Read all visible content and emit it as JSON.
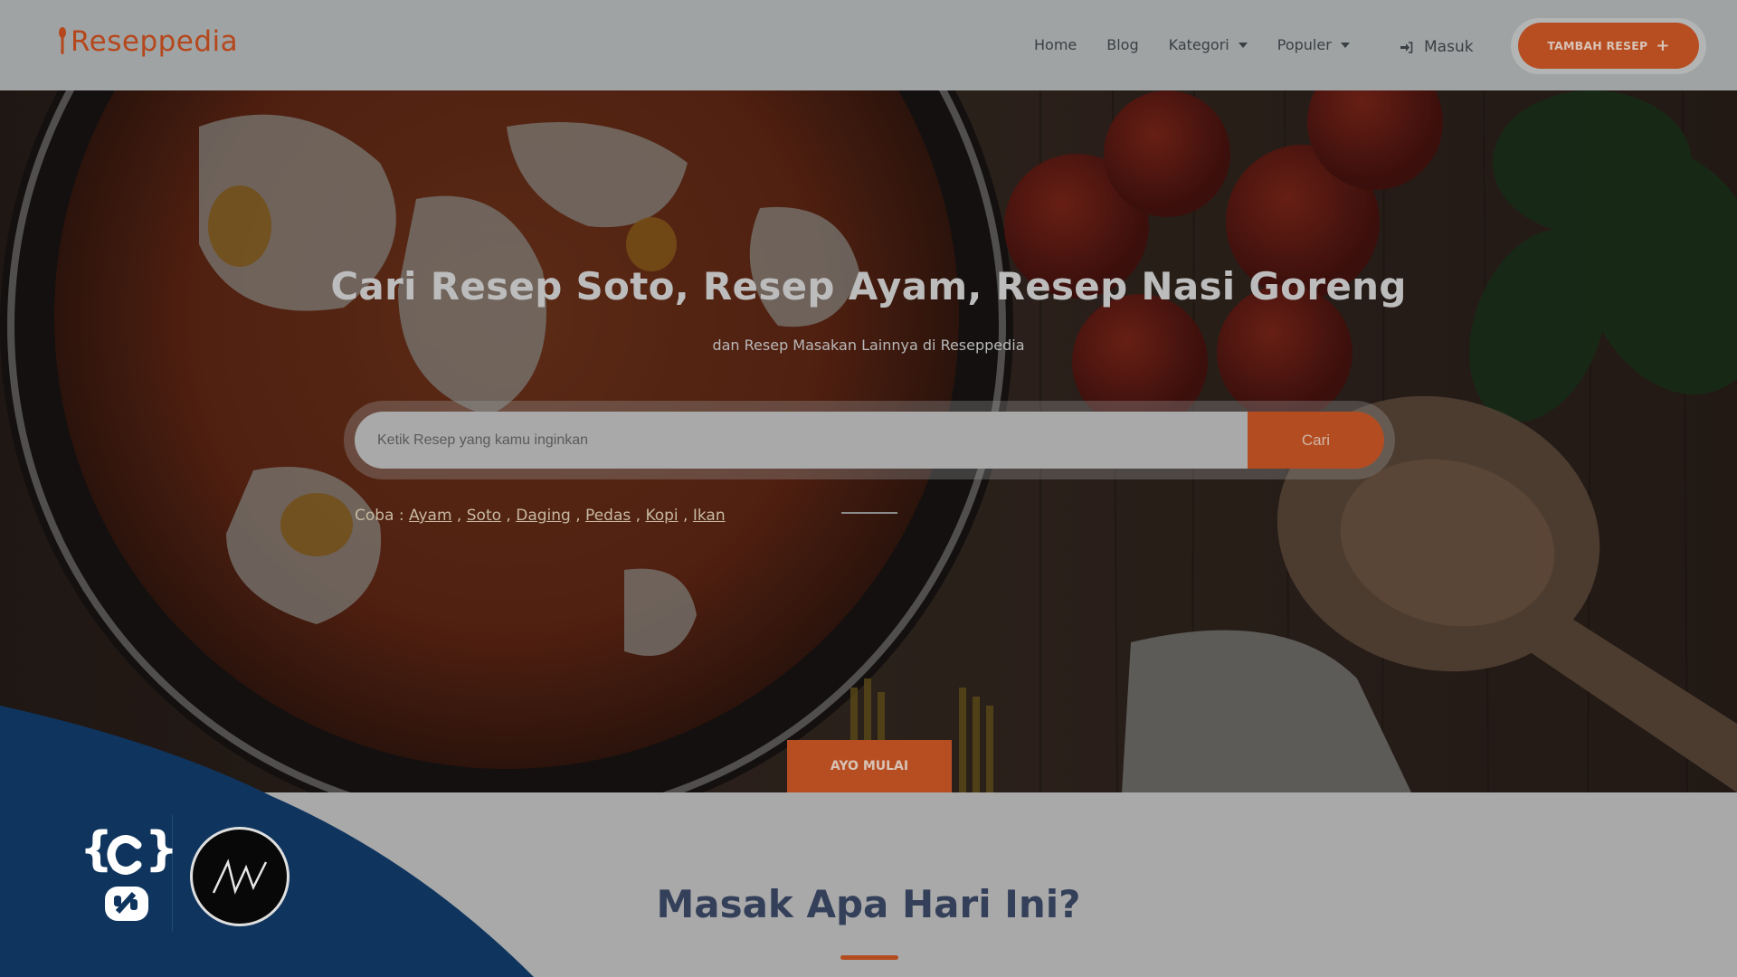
{
  "header": {
    "brand": "Reseppedia",
    "nav": [
      {
        "label": "Home",
        "has_dropdown": false
      },
      {
        "label": "Blog",
        "has_dropdown": false
      },
      {
        "label": "Kategori",
        "has_dropdown": true
      },
      {
        "label": "Populer",
        "has_dropdown": true
      }
    ],
    "login_label": "Masuk",
    "login_icon": "sign-in-icon",
    "add_recipe_label": "TAMBAH RESEP",
    "add_recipe_icon": "plus-icon"
  },
  "hero": {
    "title": "Cari Resep Soto, Resep Ayam, Resep Nasi Goreng",
    "subtitle": "dan Resep Masakan Lainnya di Reseppedia",
    "search": {
      "placeholder": "Ketik Resep yang kamu inginkan",
      "value": "",
      "button_label": "Cari"
    },
    "suggestions": {
      "prefix": "Coba :",
      "items": [
        "Ayam",
        "Soto",
        "Daging",
        "Pedas",
        "Kopi",
        "Ikan"
      ],
      "separator": ","
    },
    "cta_label": "AYO MULAI"
  },
  "section": {
    "title": "Masak Apa Hari Ini?"
  },
  "colors": {
    "accent": "#b74e22",
    "heading": "#34405a",
    "wave": "#0f355f"
  },
  "overlay_logos": [
    "code-braces-logo",
    "aw-logo"
  ]
}
